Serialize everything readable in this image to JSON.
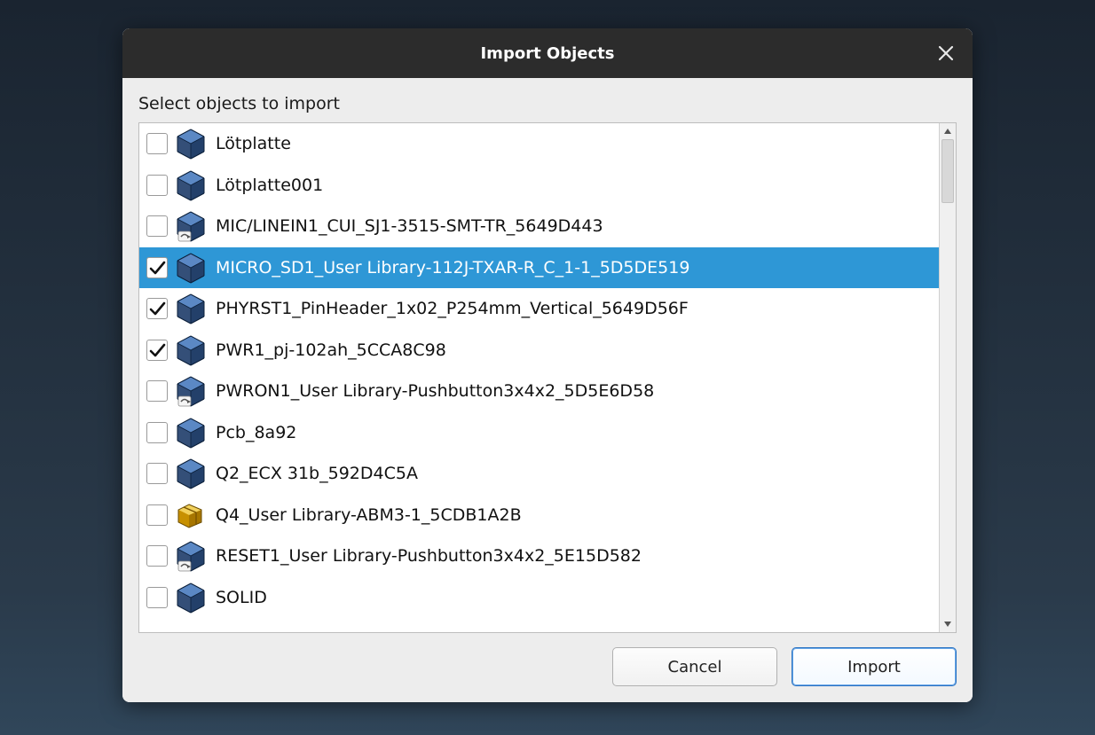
{
  "dialog": {
    "title": "Import Objects",
    "instruction": "Select objects to import"
  },
  "items": [
    {
      "label": "Lötplatte",
      "checked": false,
      "selected": false,
      "icon": "box"
    },
    {
      "label": "Lötplatte001",
      "checked": false,
      "selected": false,
      "icon": "box"
    },
    {
      "label": "MIC/LINEIN1_CUI_SJ1-3515-SMT-TR_5649D443",
      "checked": false,
      "selected": false,
      "icon": "boxlink"
    },
    {
      "label": "MICRO_SD1_User Library-112J-TXAR-R_C_1-1_5D5DE519",
      "checked": true,
      "selected": true,
      "icon": "box"
    },
    {
      "label": "PHYRST1_PinHeader_1x02_P254mm_Vertical_5649D56F",
      "checked": true,
      "selected": false,
      "icon": "box"
    },
    {
      "label": "PWR1_pj-102ah_5CCA8C98",
      "checked": true,
      "selected": false,
      "icon": "box"
    },
    {
      "label": "PWRON1_User Library-Pushbutton3x4x2_5D5E6D58",
      "checked": false,
      "selected": false,
      "icon": "boxlink"
    },
    {
      "label": "Pcb_8a92",
      "checked": false,
      "selected": false,
      "icon": "box"
    },
    {
      "label": "Q2_ECX 31b_592D4C5A",
      "checked": false,
      "selected": false,
      "icon": "box"
    },
    {
      "label": "Q4_User Library-ABM3-1_5CDB1A2B",
      "checked": false,
      "selected": false,
      "icon": "package"
    },
    {
      "label": "RESET1_User Library-Pushbutton3x4x2_5E15D582",
      "checked": false,
      "selected": false,
      "icon": "boxlink"
    },
    {
      "label": "SOLID",
      "checked": false,
      "selected": false,
      "icon": "box"
    }
  ],
  "buttons": {
    "cancel": "Cancel",
    "import": "Import"
  }
}
